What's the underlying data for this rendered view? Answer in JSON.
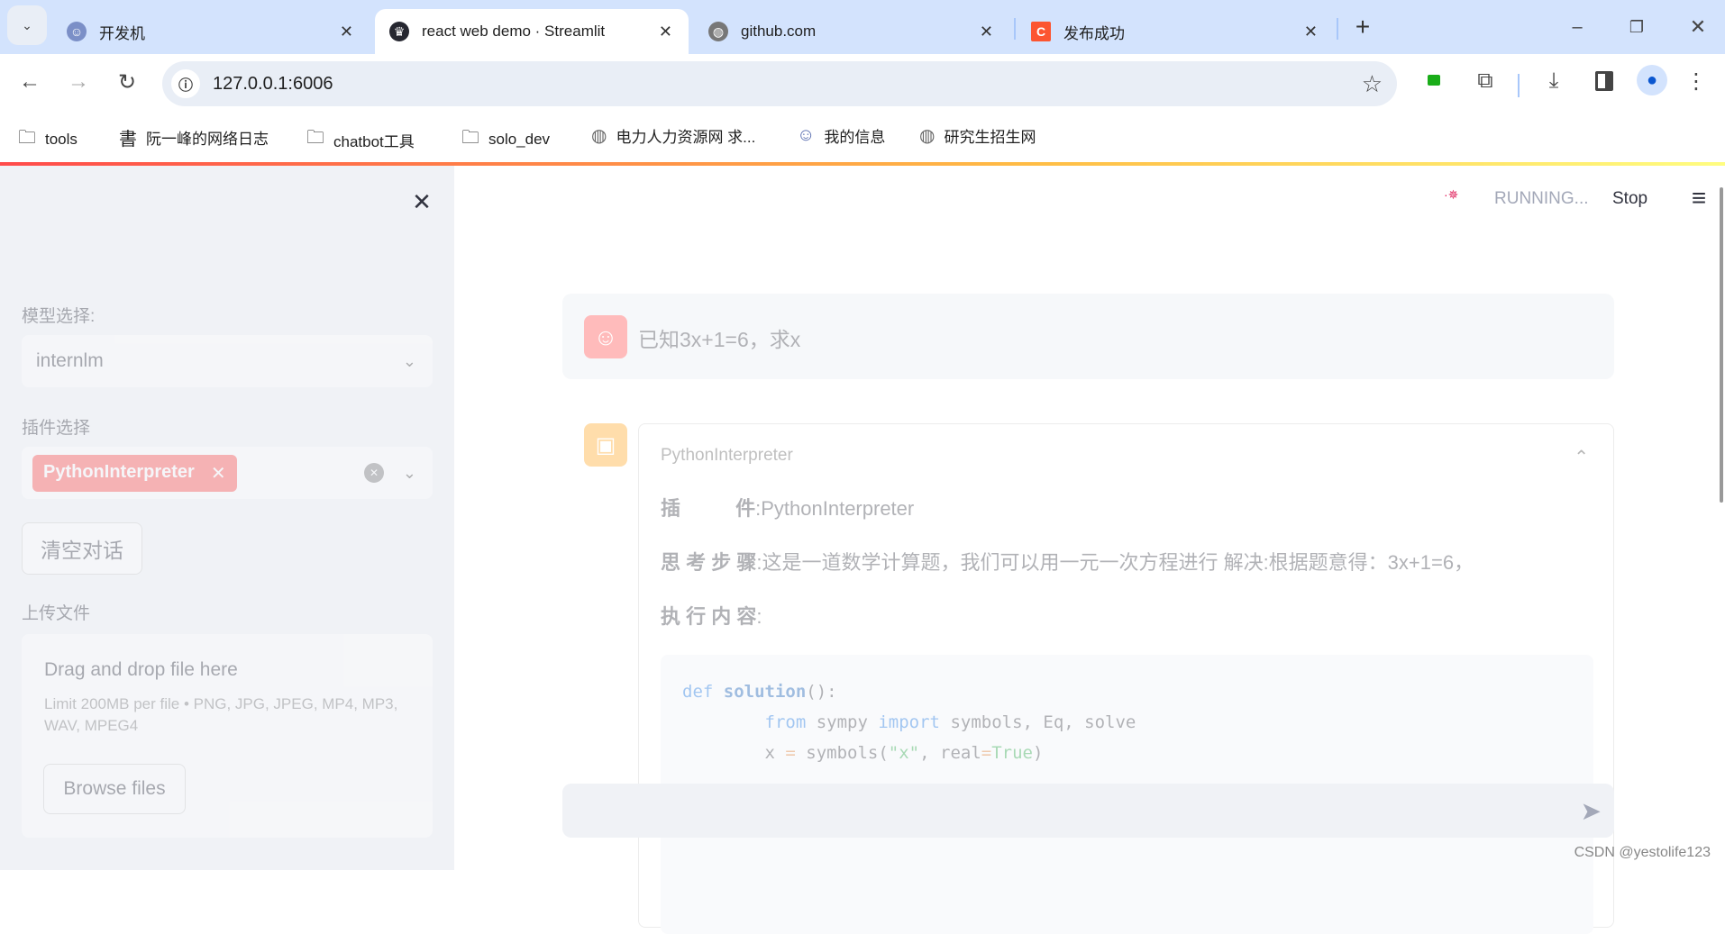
{
  "browser": {
    "tabs": [
      {
        "title": "开发机",
        "icon": "avatar-favicon",
        "active": false
      },
      {
        "title": "react  web  demo · Streamlit",
        "icon": "streamlit-crown-favicon",
        "active": true
      },
      {
        "title": "github.com",
        "icon": "globe-icon",
        "active": false
      },
      {
        "title": "发布成功",
        "icon": "csdn-favicon",
        "active": false
      }
    ],
    "url": "127.0.0.1:6006",
    "bookmarks": [
      {
        "label": "tools",
        "icon": "folder-icon"
      },
      {
        "label": "阮一峰的网络日志",
        "icon": "calligraphy-favicon"
      },
      {
        "label": "chatbot工具",
        "icon": "folder-icon"
      },
      {
        "label": "solo_dev",
        "icon": "folder-icon"
      },
      {
        "label": "电力人力资源网 求...",
        "icon": "globe-icon"
      },
      {
        "label": "我的信息",
        "icon": "avatar-favicon"
      },
      {
        "label": "研究生招生网",
        "icon": "globe-icon"
      }
    ]
  },
  "sidebar": {
    "model_label": "模型选择:",
    "model_value": "internlm",
    "plugin_label": "插件选择",
    "plugin_tag": "PythonInterpreter",
    "clear_button": "清空对话",
    "upload_label": "上传文件",
    "drop_title": "Drag and drop file here",
    "drop_limit": "Limit 200MB per file • PNG, JPG, JPEG, MP4, MP3, WAV, MPEG4",
    "browse_button": "Browse files"
  },
  "header": {
    "status": "RUNNING...",
    "stop": "Stop"
  },
  "chat": {
    "user_message": "已知3x+1=6，求x",
    "expander_title": "PythonInterpreter",
    "plugin_key": "插          件",
    "plugin_value": ":PythonInterpreter",
    "thought_key": "思 考 步 骤",
    "thought_value": ":这是一道数学计算题，我们可以用一元一次方程进行 解决:根据题意得：3x+1=6，",
    "exec_key": "执 行 内 容",
    "exec_value": ":",
    "code_lines": [
      [
        {
          "t": "def ",
          "c": "kw"
        },
        {
          "t": "solution",
          "c": "fn"
        },
        {
          "t": "():",
          "c": "p"
        }
      ],
      [
        {
          "t": "        from ",
          "c": "kw"
        },
        {
          "t": "sympy ",
          "c": "p"
        },
        {
          "t": "import ",
          "c": "kw"
        },
        {
          "t": "symbols, Eq, solve",
          "c": "p"
        }
      ],
      [
        {
          "t": "        x ",
          "c": "p"
        },
        {
          "t": "= ",
          "c": "op"
        },
        {
          "t": "symbols(",
          "c": "p"
        },
        {
          "t": "\"x\"",
          "c": "str"
        },
        {
          "t": ", real",
          "c": "p"
        },
        {
          "t": "=",
          "c": "op"
        },
        {
          "t": "True",
          "c": "str"
        },
        {
          "t": ")",
          "c": "p"
        }
      ]
    ],
    "input_placeholder": ""
  },
  "watermark": "CSDN @yestolife123",
  "colors": {
    "accent": "#ff4b4b",
    "user_avatar": "#ff6c6c",
    "bot_avatar": "#ffbd45",
    "sidebar_bg": "#f0f2f6",
    "tag_bg": "#ff4b4b"
  }
}
